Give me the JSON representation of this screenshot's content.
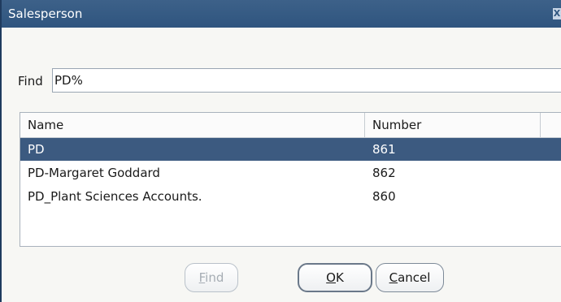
{
  "dialog": {
    "title": "Salesperson",
    "close_glyph": "X"
  },
  "find": {
    "label": "Find",
    "value": "PD%"
  },
  "table": {
    "columns": [
      "Name",
      "Number"
    ],
    "rows": [
      {
        "name": "PD",
        "number": "861",
        "selected": true
      },
      {
        "name": "PD-Margaret Goddard",
        "number": "862",
        "selected": false
      },
      {
        "name": "PD_Plant Sciences Accounts.",
        "number": "860",
        "selected": false
      }
    ]
  },
  "buttons": {
    "find": {
      "mnemonic": "F",
      "rest": "ind",
      "enabled": false
    },
    "ok": {
      "mnemonic": "O",
      "rest": "K"
    },
    "cancel": {
      "mnemonic": "C",
      "rest": "ancel"
    }
  },
  "colors": {
    "titlebar": "#2f557f",
    "selection": "#3c5a80"
  }
}
